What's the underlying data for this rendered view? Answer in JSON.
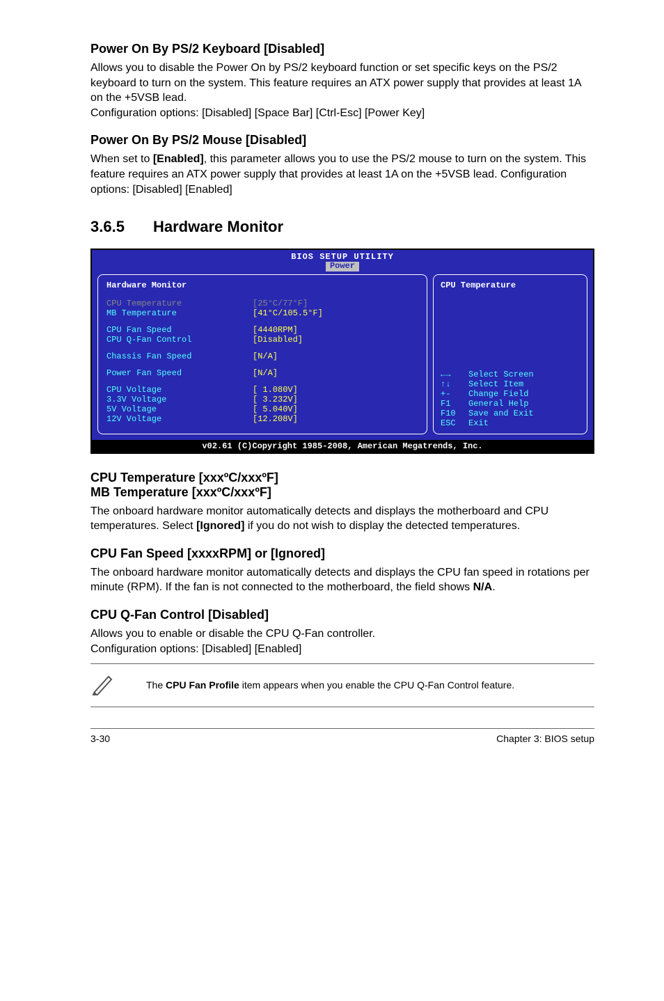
{
  "section_ps2kb": {
    "heading": "Power On By PS/2 Keyboard [Disabled]",
    "body": "Allows you to disable the Power On by PS/2 keyboard function or set specific keys on the PS/2 keyboard to turn on the system. This feature requires an ATX power supply that provides at least 1A on the +5VSB lead.\nConfiguration options: [Disabled] [Space Bar] [Ctrl-Esc] [Power Key]"
  },
  "section_ps2mouse": {
    "heading": "Power On By PS/2 Mouse [Disabled]",
    "body_pre": "When set to ",
    "body_bold": "[Enabled]",
    "body_post": ", this parameter allows you to use the PS/2 mouse to turn on the system. This feature requires an ATX power supply that provides at least 1A on the +5VSB lead. Configuration options: [Disabled] [Enabled]"
  },
  "section_hwmon": {
    "number": "3.6.5",
    "title": "Hardware Monitor"
  },
  "bios": {
    "title": "BIOS SETUP UTILITY",
    "tab": "Power",
    "panel_title": "Hardware Monitor",
    "right_title": "CPU Temperature",
    "rows_temp": [
      {
        "label": "CPU Temperature",
        "value": "[25°C/77°F]",
        "label_color": "grey",
        "value_color": "grey"
      },
      {
        "label": "MB Temperature",
        "value": "[41°C/105.5°F]",
        "label_color": "cyan",
        "value_color": "yellow"
      }
    ],
    "rows_fan1": [
      {
        "label": "CPU Fan Speed",
        "value": "[4440RPM]",
        "label_color": "cyan",
        "value_color": "yellow"
      },
      {
        "label": "CPU Q-Fan Control",
        "value": "[Disabled]",
        "label_color": "cyan",
        "value_color": "yellow"
      }
    ],
    "rows_fan2": [
      {
        "label": "Chassis Fan Speed",
        "value": "[N/A]",
        "label_color": "cyan",
        "value_color": "yellow"
      }
    ],
    "rows_fan3": [
      {
        "label": "Power Fan Speed",
        "value": "[N/A]",
        "label_color": "cyan",
        "value_color": "yellow"
      }
    ],
    "rows_volt": [
      {
        "label": "CPU Voltage",
        "value": "[ 1.080V]",
        "label_color": "cyan",
        "value_color": "yellow"
      },
      {
        "label": "3.3V Voltage",
        "value": "[ 3.232V]",
        "label_color": "cyan",
        "value_color": "yellow"
      },
      {
        "label": "5V Voltage",
        "value": "[ 5.040V]",
        "label_color": "cyan",
        "value_color": "yellow"
      },
      {
        "label": "12V Voltage",
        "value": "[12.208V]",
        "label_color": "cyan",
        "value_color": "yellow"
      }
    ],
    "help": [
      {
        "key": "←→",
        "text": "Select Screen"
      },
      {
        "key": "↑↓",
        "text": "Select Item"
      },
      {
        "key": "+-",
        "text": "Change Field"
      },
      {
        "key": "F1",
        "text": "General Help"
      },
      {
        "key": "F10",
        "text": "Save and Exit"
      },
      {
        "key": "ESC",
        "text": "Exit"
      }
    ],
    "footer": "v02.61 (C)Copyright 1985-2008, American Megatrends, Inc."
  },
  "section_temp": {
    "heading1": "CPU Temperature [xxxºC/xxxºF]",
    "heading2": "MB Temperature [xxxºC/xxxºF]",
    "body_pre": "The onboard hardware monitor automatically detects and displays the motherboard and CPU temperatures. Select ",
    "body_bold": "[Ignored]",
    "body_post": " if you do not wish to display the detected temperatures."
  },
  "section_fanspeed": {
    "heading": "CPU Fan Speed [xxxxRPM] or [Ignored]",
    "body_pre": "The onboard hardware monitor automatically detects and displays the CPU fan speed in rotations per minute (RPM). If the fan is not connected to the motherboard, the field shows ",
    "body_bold": "N/A",
    "body_post": "."
  },
  "section_qfan": {
    "heading": "CPU Q-Fan Control [Disabled]",
    "body": "Allows you to enable or disable the CPU Q-Fan controller.\nConfiguration options: [Disabled] [Enabled]"
  },
  "note": {
    "pre": "The ",
    "bold": "CPU Fan Profile",
    "post": " item appears when you enable the CPU Q-Fan Control feature."
  },
  "footer": {
    "left": "3-30",
    "right": "Chapter 3: BIOS setup"
  }
}
